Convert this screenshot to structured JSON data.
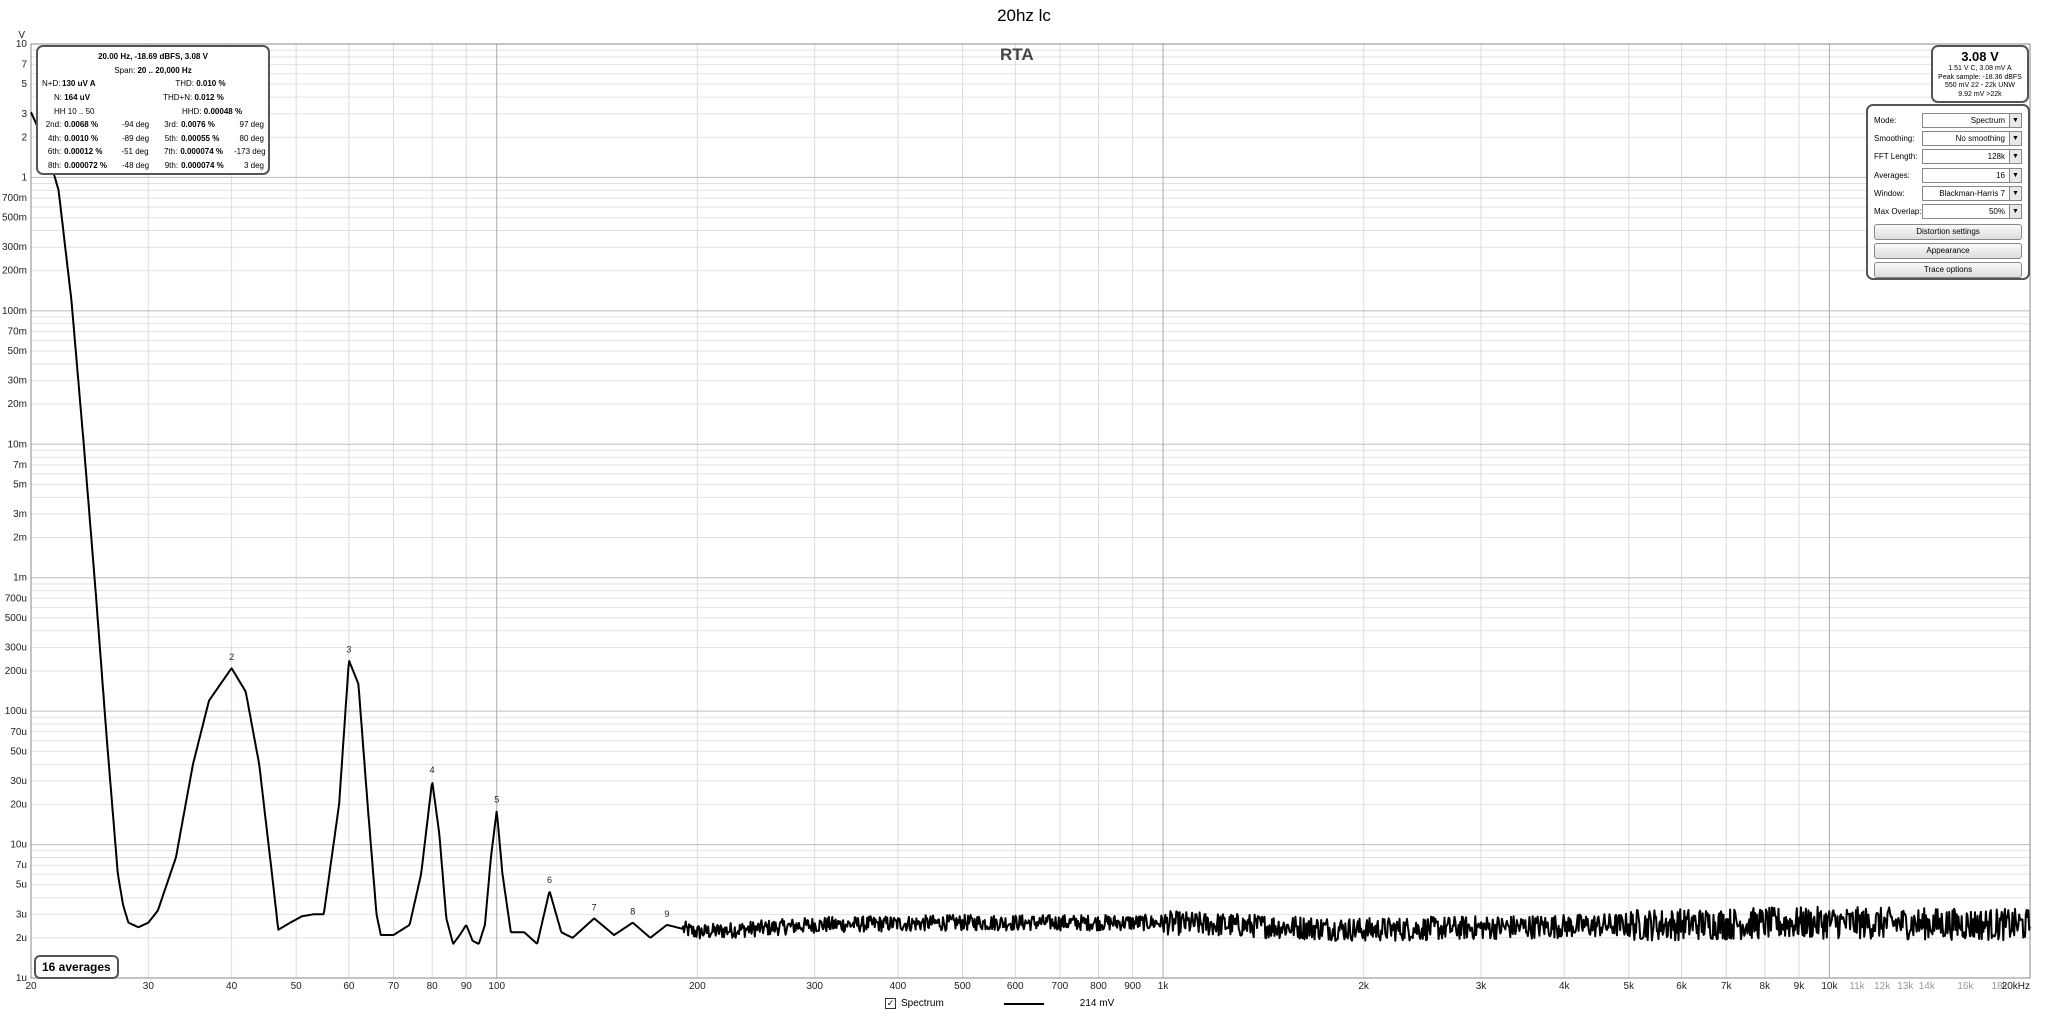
{
  "window": {
    "title": "20hz lc",
    "rta_label": "RTA"
  },
  "info_box": {
    "header": "20.00 Hz, -18.69 dBFS, 3.08 V",
    "span": {
      "label": "Span:",
      "value": "20 .. 20,000 Hz"
    },
    "nd": {
      "label": "N+D:",
      "value": "130 uV A"
    },
    "thd": {
      "label": "THD:",
      "value": "0.010 %"
    },
    "n": {
      "label": "N:",
      "value": "164 uV"
    },
    "thdn": {
      "label": "THD+N:",
      "value": "0.012 %"
    },
    "hh": {
      "label": "HH 10 .. 50",
      "hhd_label": "HHD:",
      "hhd_value": "0.00048 %"
    },
    "harmonics": [
      {
        "l1": "2nd:",
        "v1": "0.0068 %",
        "d1": "-94 deg",
        "l2": "3rd:",
        "v2": "0.0076 %",
        "d2": "97 deg"
      },
      {
        "l1": "4th:",
        "v1": "0.0010 %",
        "d1": "-89 deg",
        "l2": "5th:",
        "v2": "0.00055 %",
        "d2": "80 deg"
      },
      {
        "l1": "6th:",
        "v1": "0.00012 %",
        "d1": "-51 deg",
        "l2": "7th:",
        "v2": "0.000074 %",
        "d2": "-173 deg"
      },
      {
        "l1": "8th:",
        "v1": "0.000072 %",
        "d1": "-48 deg",
        "l2": "9th:",
        "v2": "0.000074 %",
        "d2": "3 deg"
      }
    ]
  },
  "level_box": {
    "value": "3.08 V",
    "lines": [
      "1.51 V C, 3.08 mV A",
      "Peak sample: -18.36 dBFS",
      "550 mV 22 - 22k UNW",
      "9.92 mV >22k"
    ]
  },
  "controls": {
    "mode": {
      "label": "Mode:",
      "value": "Spectrum"
    },
    "smoothing": {
      "label": "Smoothing:",
      "value": "No smoothing"
    },
    "fft": {
      "label": "FFT Length:",
      "value": "128k"
    },
    "averages": {
      "label": "Averages:",
      "value": "16"
    },
    "window": {
      "label": "Window:",
      "value": "Blackman-Harris 7"
    },
    "overlap": {
      "label": "Max Overlap:",
      "value": "50%"
    },
    "distortion_btn": "Distortion settings",
    "appearance_btn": "Appearance",
    "trace_btn": "Trace options"
  },
  "averages_badge": "16 averages",
  "legend": {
    "name": "Spectrum",
    "value": "214 mV",
    "checked": "✓"
  },
  "chart_data": {
    "type": "line",
    "title": "20hz lc",
    "x_scale": "log",
    "y_scale": "log",
    "xlim": [
      20,
      20000
    ],
    "ylim": [
      1e-06,
      10
    ],
    "y_unit": "V",
    "grid": true,
    "x_ticks": [
      "20",
      "30",
      "40",
      "50",
      "60",
      "70",
      "80",
      "90",
      "100",
      "200",
      "300",
      "400",
      "500",
      "600",
      "700",
      "800",
      "900",
      "1k",
      "2k",
      "3k",
      "4k",
      "5k",
      "6k",
      "7k",
      "8k",
      "9k",
      "10k",
      "11k",
      "12k",
      "13k",
      "14k",
      "16k",
      "18k",
      "20kHz"
    ],
    "x_ticks_light": [
      "11k",
      "12k",
      "13k",
      "14k",
      "16k",
      "18k"
    ],
    "y_ticks": [
      "10",
      "7",
      "5",
      "3",
      "2",
      "1",
      "700m",
      "500m",
      "300m",
      "200m",
      "100m",
      "70m",
      "50m",
      "30m",
      "20m",
      "10m",
      "7m",
      "5m",
      "3m",
      "2m",
      "1m",
      "700u",
      "500u",
      "300u",
      "200u",
      "100u",
      "70u",
      "50u",
      "30u",
      "20u",
      "10u",
      "7u",
      "5u",
      "3u",
      "2u",
      "1u"
    ],
    "series": [
      {
        "name": "Spectrum",
        "x": [
          20,
          21,
          22,
          23,
          24,
          25,
          26,
          27,
          27.5,
          28,
          29,
          30,
          31,
          33,
          35,
          37,
          40,
          42,
          44,
          46,
          47,
          49,
          51,
          53,
          55,
          58,
          60,
          62,
          64,
          66,
          67,
          70,
          74,
          77,
          80,
          82,
          84,
          86,
          88,
          90,
          92,
          94,
          96,
          98,
          100,
          102,
          105,
          110,
          115,
          120,
          125,
          130,
          140,
          150,
          160,
          170,
          180,
          200,
          300,
          500,
          1000,
          2000,
          5000,
          10000,
          20000
        ],
        "y": [
          3.08,
          1.8,
          0.8,
          0.12,
          0.01,
          0.0008,
          6e-05,
          6e-06,
          3.5e-06,
          2.6e-06,
          2.4e-06,
          2.6e-06,
          3.2e-06,
          8e-06,
          4e-05,
          0.00012,
          0.00021,
          0.00014,
          4e-05,
          6e-06,
          2.3e-06,
          2.6e-06,
          2.9e-06,
          3e-06,
          3e-06,
          2e-05,
          0.00024,
          0.00016,
          2e-05,
          3e-06,
          2.1e-06,
          2.1e-06,
          2.5e-06,
          6e-06,
          3e-05,
          1.2e-05,
          2.8e-06,
          1.8e-06,
          2.1e-06,
          2.5e-06,
          1.9e-06,
          1.8e-06,
          2.5e-06,
          8e-06,
          1.8e-05,
          6e-06,
          2.2e-06,
          2.2e-06,
          1.8e-06,
          4.5e-06,
          2.2e-06,
          2e-06,
          2.8e-06,
          2.1e-06,
          2.6e-06,
          2e-06,
          2.5e-06,
          2.2e-06,
          2.5e-06,
          2.6e-06,
          2.6e-06,
          2.3e-06,
          2.5e-06,
          2.6e-06,
          2.5e-06
        ]
      }
    ],
    "harmonic_markers": [
      {
        "label": "2",
        "x": 40,
        "y": 0.00021
      },
      {
        "label": "3",
        "x": 60,
        "y": 0.00024
      },
      {
        "label": "4",
        "x": 80,
        "y": 3e-05
      },
      {
        "label": "5",
        "x": 100,
        "y": 1.8e-05
      },
      {
        "label": "6",
        "x": 120,
        "y": 4.5e-06
      },
      {
        "label": "7",
        "x": 140,
        "y": 2.8e-06
      },
      {
        "label": "8",
        "x": 160,
        "y": 2.6e-06
      },
      {
        "label": "9",
        "x": 180,
        "y": 2.5e-06
      }
    ]
  }
}
